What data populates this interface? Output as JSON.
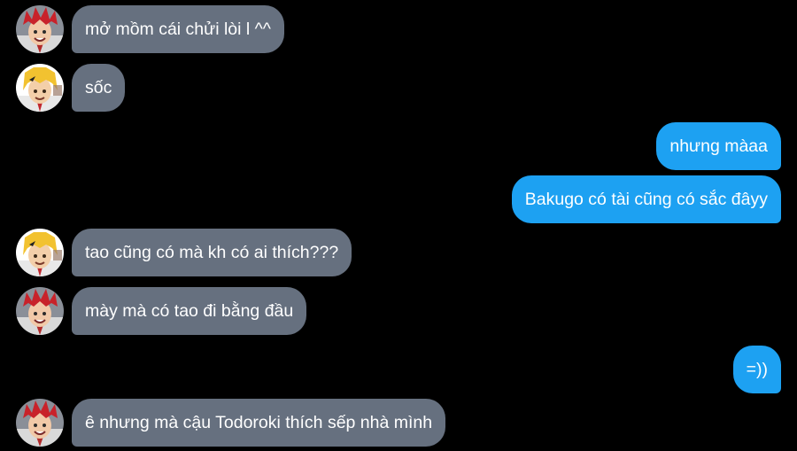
{
  "conversation": {
    "messages": [
      {
        "id": "m1",
        "sender": "kirishima",
        "direction": "incoming",
        "text": "mở mồm cái chửi lòi l ^^"
      },
      {
        "id": "m2",
        "sender": "kaminari",
        "direction": "incoming",
        "text": "sốc"
      },
      {
        "id": "m3",
        "sender": "me",
        "direction": "outgoing",
        "text": "nhưng màaa"
      },
      {
        "id": "m4",
        "sender": "me",
        "direction": "outgoing",
        "text": "Bakugo có tài cũng có sắc đâyy"
      },
      {
        "id": "m5",
        "sender": "kaminari",
        "direction": "incoming",
        "text": "tao cũng có mà kh có ai thích???"
      },
      {
        "id": "m6",
        "sender": "kirishima",
        "direction": "incoming",
        "text": "mày mà có tao đi bằng đầu"
      },
      {
        "id": "m7",
        "sender": "me",
        "direction": "outgoing",
        "text": "=))"
      },
      {
        "id": "m8",
        "sender": "kirishima",
        "direction": "incoming",
        "text": "ê nhưng mà cậu Todoroki thích sếp nhà mình"
      }
    ]
  },
  "avatars": {
    "kirishima": {
      "icon": "red-spiky-hair-avatar-icon",
      "hair_color": "#c8222a"
    },
    "kaminari": {
      "icon": "blonde-hair-avatar-icon",
      "hair_color": "#f2c230"
    }
  },
  "colors": {
    "background": "#000000",
    "incoming_bubble": "#66707f",
    "outgoing_bubble": "#1da1f2",
    "text": "#ffffff"
  }
}
